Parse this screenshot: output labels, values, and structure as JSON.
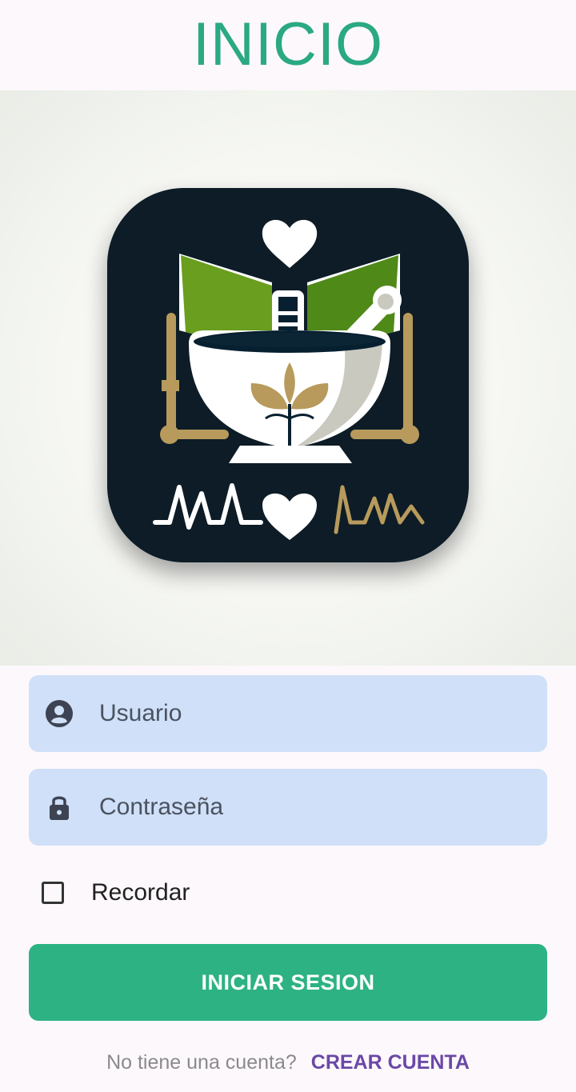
{
  "header": {
    "title": "INICIO"
  },
  "hero": {
    "logo_icon": "pharmacy-medicine-logo"
  },
  "form": {
    "username": {
      "placeholder": "Usuario",
      "icon": "account-circle-icon"
    },
    "password": {
      "placeholder": "Contraseña",
      "icon": "lock-icon"
    },
    "remember": {
      "label": "Recordar",
      "checked": false
    },
    "submit_label": "INICIAR SESION"
  },
  "footer": {
    "question": "No tiene una cuenta?",
    "link_label": "CREAR CUENTA"
  },
  "colors": {
    "accent": "#2db283",
    "title": "#2aa983",
    "field_bg": "#cfe0f8",
    "link": "#6a48a6"
  }
}
